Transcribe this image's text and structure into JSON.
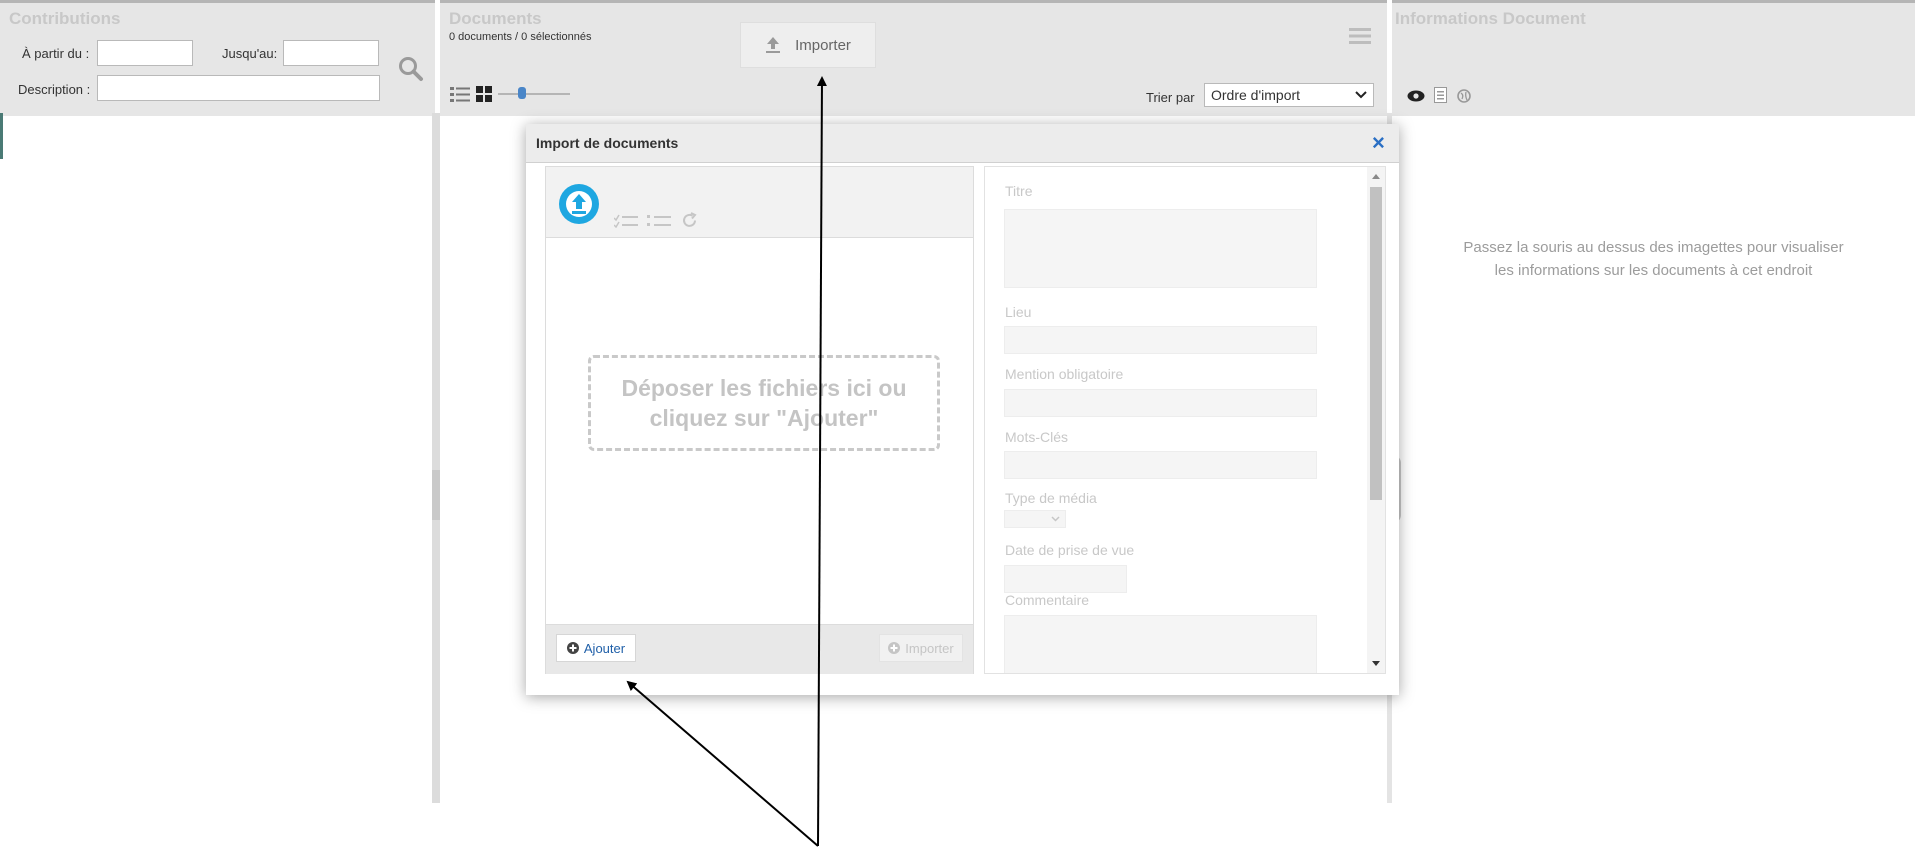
{
  "contributions": {
    "title": "Contributions",
    "from_label": "À partir du :",
    "to_label": "Jusqu'au:",
    "description_label": "Description :",
    "from_value": "",
    "to_value": "",
    "description_value": ""
  },
  "documents": {
    "title": "Documents",
    "count_text": "0 documents / 0 sélectionnés",
    "import_label": "Importer",
    "sort_label": "Trier par",
    "sort_selected": "Ordre d'import"
  },
  "info": {
    "title": "Informations Document",
    "hint_line1": "Passez la souris au dessus des imagettes pour visualiser",
    "hint_line2": "les informations sur les documents à cet endroit"
  },
  "modal": {
    "title": "Import de documents",
    "close": "×",
    "drop_line1": "Déposer les fichiers ici ou",
    "drop_line2": "cliquez sur \"Ajouter\"",
    "add_label": "Ajouter",
    "import_label": "Importer",
    "fields": {
      "titre": "Titre",
      "lieu": "Lieu",
      "mention": "Mention obligatoire",
      "mots": "Mots-Clés",
      "type": "Type de média",
      "date": "Date de prise de vue",
      "commentaire": "Commentaire"
    }
  },
  "colors": {
    "accent_blue": "#1ea7e1",
    "link_blue": "#1f5fa8",
    "panel_bg": "#e6e6e6"
  }
}
